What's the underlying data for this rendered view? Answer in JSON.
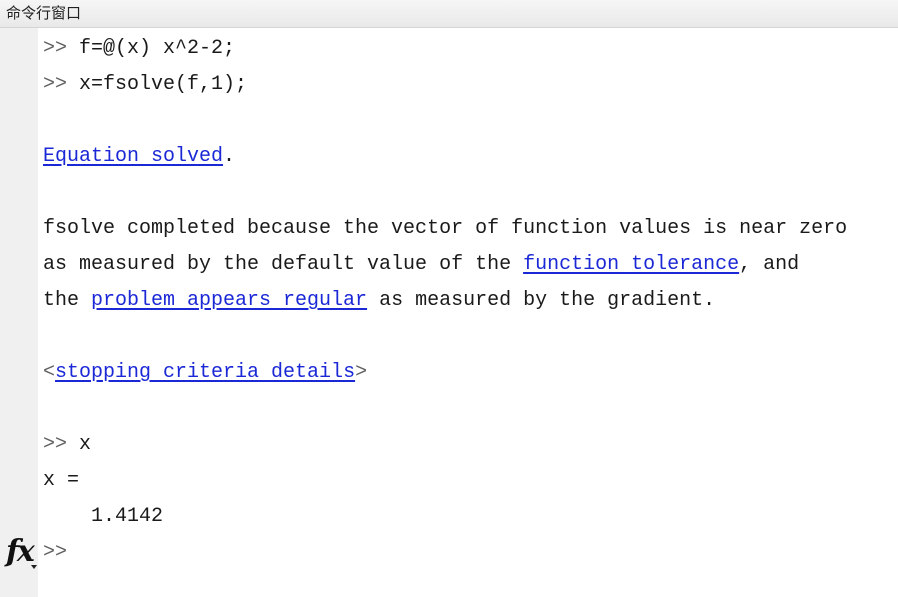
{
  "window": {
    "title": "命令行窗口"
  },
  "console": {
    "prompt": ">>",
    "cmd1": "f=@(x) x^2-2;",
    "cmd2": "x=fsolve(f,1);",
    "equation_solved_link": "Equation solved",
    "equation_solved_period": ".",
    "msg_line1": "fsolve completed because the vector of function values is near zero",
    "msg_line2_pre": "as measured by the default value of the ",
    "function_tolerance_link": "function tolerance",
    "msg_line2_post": ", and",
    "msg_line3_pre": "the ",
    "problem_regular_link": "problem appears regular",
    "msg_line3_post": " as measured by the gradient.",
    "angle_open": "<",
    "stopping_criteria_link": "stopping criteria details",
    "angle_close": ">",
    "cmd3": "x",
    "output_label": "x =",
    "output_value": "1.4142",
    "final_prompt": ">>"
  },
  "icons": {
    "function_browser": "fx"
  }
}
